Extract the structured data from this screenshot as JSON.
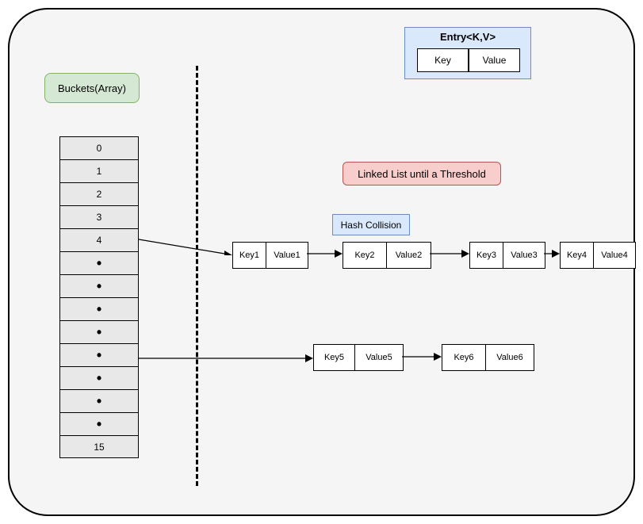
{
  "buckets_label": "Buckets(Array)",
  "entry": {
    "title": "Entry<K,V>",
    "key": "Key",
    "value": "Value"
  },
  "array_indices": [
    "0",
    "1",
    "2",
    "3",
    "4",
    "•",
    "•",
    "•",
    "•",
    "•",
    "•",
    "•",
    "•",
    "15"
  ],
  "linked_list_badge": "Linked List until a Threshold",
  "hash_collision": "Hash Collision",
  "row1": [
    {
      "k": "Key1",
      "v": "Value1"
    },
    {
      "k": "Key2",
      "v": "Value2"
    },
    {
      "k": "Key3",
      "v": "Value3"
    },
    {
      "k": "Key4",
      "v": "Value4"
    }
  ],
  "row2": [
    {
      "k": "Key5",
      "v": "Value5"
    },
    {
      "k": "Key6",
      "v": "Value6"
    }
  ]
}
